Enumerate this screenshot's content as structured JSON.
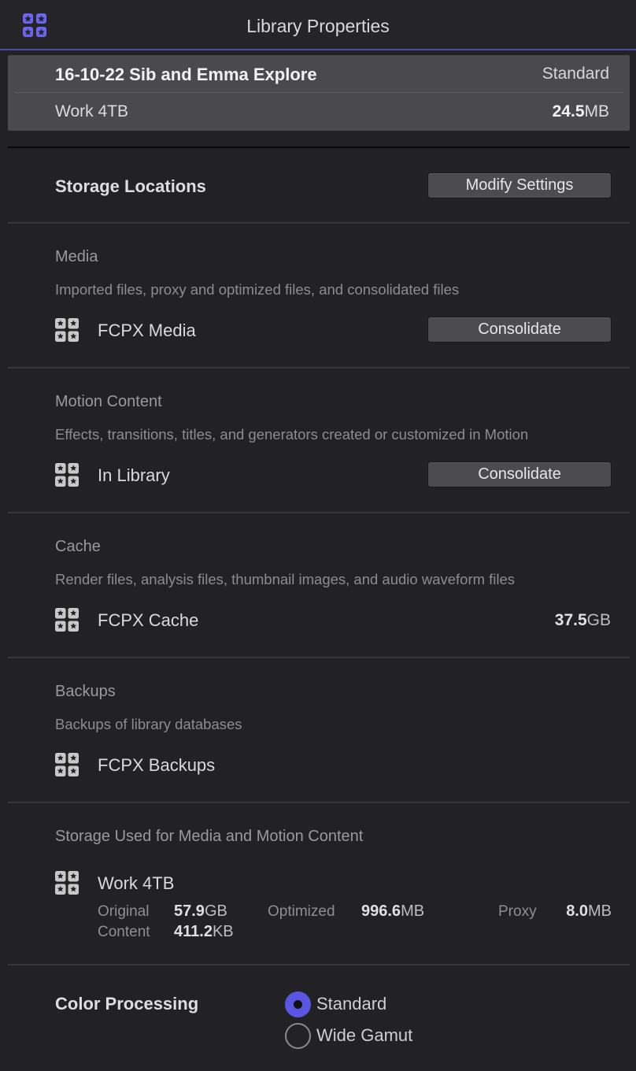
{
  "window": {
    "title": "Library Properties"
  },
  "library": {
    "name": "16-10-22 Sib and Emma Explore",
    "color_processing_badge": "Standard",
    "volume": "Work 4TB",
    "size_value": "24.5",
    "size_unit": "MB"
  },
  "storage": {
    "heading": "Storage Locations",
    "modify_button": "Modify Settings"
  },
  "media": {
    "title": "Media",
    "description": "Imported files, proxy and optimized files, and consolidated files",
    "location": "FCPX Media",
    "button": "Consolidate"
  },
  "motion": {
    "title": "Motion Content",
    "description": "Effects, transitions, titles, and generators created or customized in Motion",
    "location": "In Library",
    "button": "Consolidate"
  },
  "cache": {
    "title": "Cache",
    "description": "Render files, analysis files, thumbnail images, and audio waveform files",
    "location": "FCPX Cache",
    "size_value": "37.5",
    "size_unit": "GB"
  },
  "backups": {
    "title": "Backups",
    "description": "Backups of library databases",
    "location": "FCPX Backups"
  },
  "usage": {
    "title": "Storage Used for Media and Motion Content",
    "volume": "Work 4TB",
    "original_label": "Original",
    "original_value": "57.9",
    "original_unit": "GB",
    "optimized_label": "Optimized",
    "optimized_value": "996.6",
    "optimized_unit": "MB",
    "proxy_label": "Proxy",
    "proxy_value": "8.0",
    "proxy_unit": "MB",
    "content_label": "Content",
    "content_value": "411.2",
    "content_unit": "KB"
  },
  "color_processing": {
    "heading": "Color Processing",
    "options": [
      "Standard",
      "Wide Gamut"
    ],
    "selected": "Standard"
  },
  "colors": {
    "accent": "#5a55e2",
    "panel_bg": "#222224",
    "library_box_bg": "#4a4a4c"
  },
  "icons": {
    "title": "library-icon",
    "location": "library-icon"
  }
}
